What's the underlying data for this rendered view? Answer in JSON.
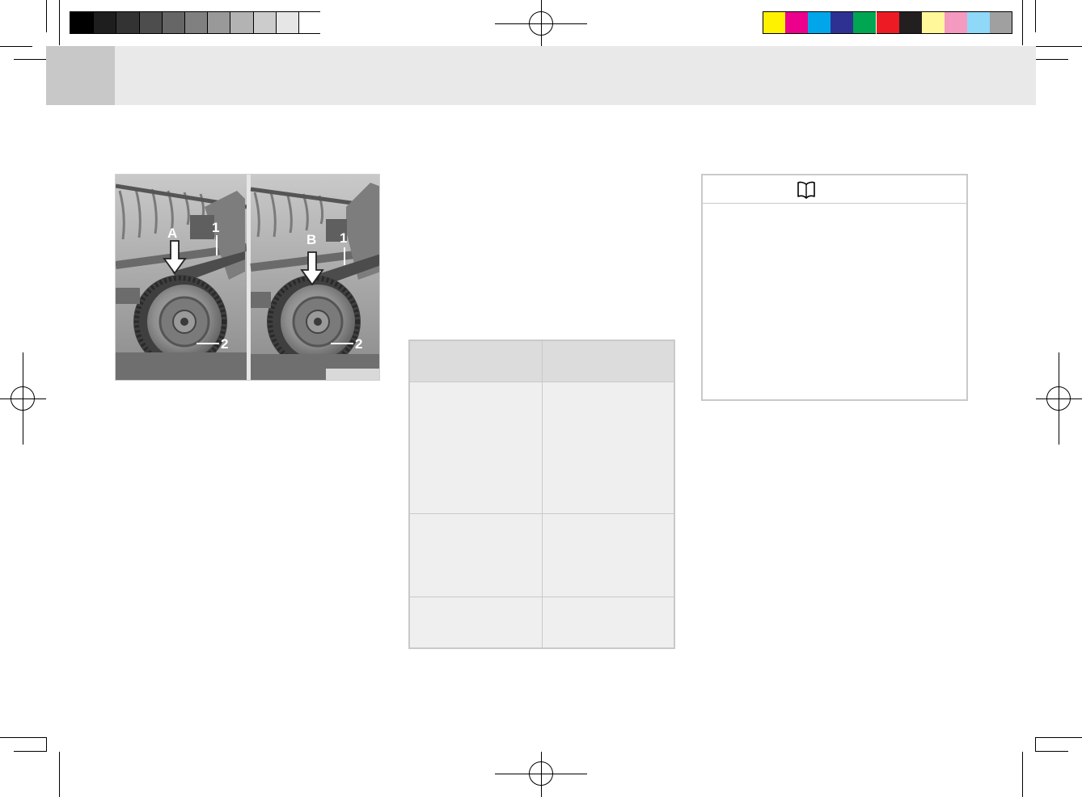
{
  "print_marks": {
    "grayscale_swatches": [
      "#000000",
      "#1e1e1e",
      "#333333",
      "#4d4d4d",
      "#666666",
      "#808080",
      "#999999",
      "#b3b3b3",
      "#cccccc",
      "#e6e6e6",
      "#ffffff"
    ],
    "color_swatches": [
      "#fff200",
      "#ec008c",
      "#00a6e9",
      "#2e3192",
      "#00a651",
      "#ed1c24",
      "#231f20",
      "#fff799",
      "#f49ac1",
      "#8fd8f8",
      "#a0a0a0"
    ]
  },
  "figure": {
    "left_panel": {
      "arrow_label": "A",
      "callout_top": "1",
      "callout_bottom": "2"
    },
    "right_panel": {
      "arrow_label": "B",
      "callout_top": "1",
      "callout_bottom": "2"
    }
  },
  "note_box": {
    "icon": "open-book-icon"
  }
}
